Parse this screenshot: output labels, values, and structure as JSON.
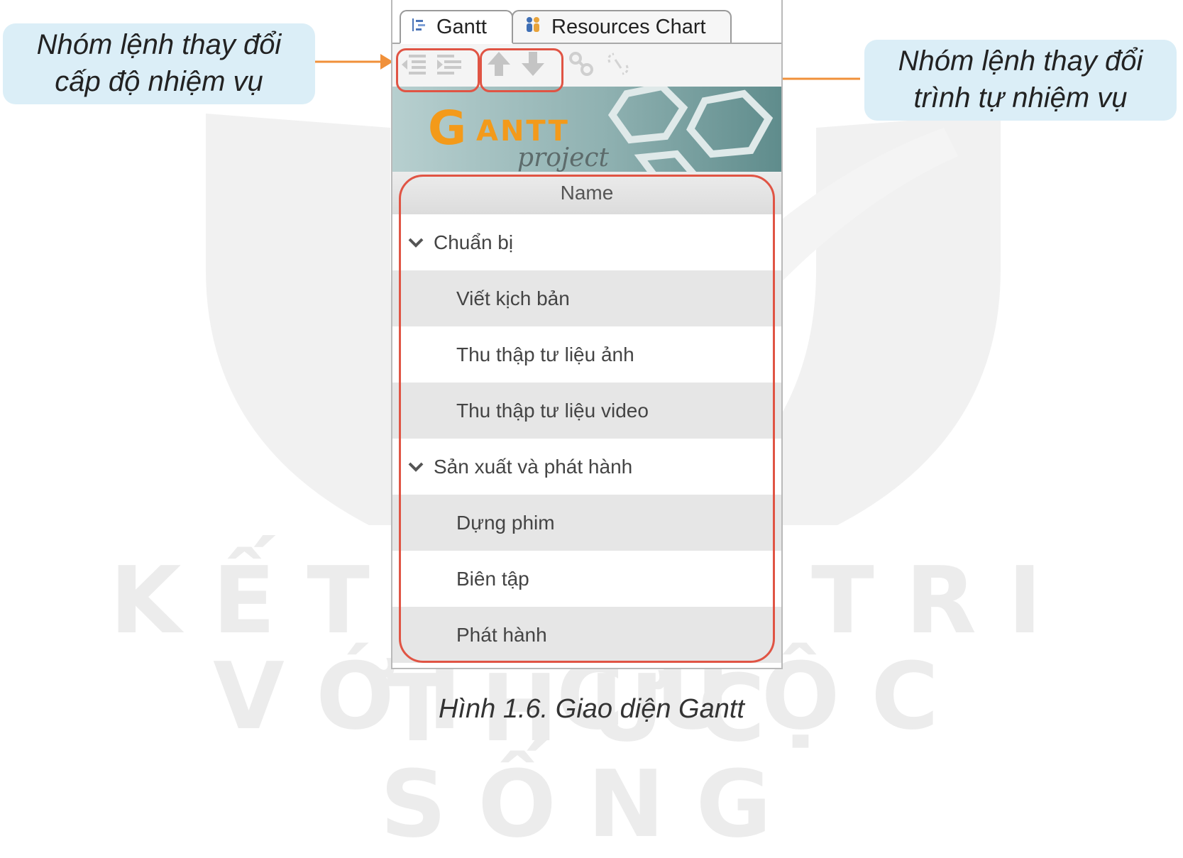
{
  "tabs": [
    {
      "label": "Gantt",
      "icon": "gantt-icon",
      "active": true
    },
    {
      "label": "Resources Chart",
      "icon": "resources-icon",
      "active": false
    }
  ],
  "toolbar": {
    "buttons": [
      "unindent-icon",
      "indent-icon",
      "move-up-icon",
      "move-down-icon",
      "link-icon",
      "unlink-icon"
    ]
  },
  "banner": {
    "logo": "GANTT project"
  },
  "table": {
    "header": "Name",
    "rows": [
      {
        "label": "Chuẩn bị",
        "level": 0,
        "expanded": true
      },
      {
        "label": "Viết kịch bản",
        "level": 1
      },
      {
        "label": "Thu thập tư liệu ảnh",
        "level": 1
      },
      {
        "label": "Thu thập tư liệu video",
        "level": 1
      },
      {
        "label": "Sản xuất và phát hành",
        "level": 0,
        "expanded": true
      },
      {
        "label": "Dựng phim",
        "level": 1
      },
      {
        "label": "Biên tập",
        "level": 1
      },
      {
        "label": "Phát hành",
        "level": 1
      }
    ]
  },
  "callouts": {
    "left": [
      "Nhóm lệnh thay đổi",
      "cấp độ nhiệm vụ"
    ],
    "right": [
      "Nhóm lệnh thay đổi",
      "trình tự nhiệm vụ"
    ]
  },
  "caption": "Hình 1.6. Giao diện Gantt",
  "watermark": [
    "KẾT NỐI TRI THỨC",
    "VỚI CUỘC SỐNG"
  ],
  "colors": {
    "highlight": "#e05444",
    "callout_bg": "#dbeef7",
    "arrow": "#f0903a",
    "logo": "#f39a1a"
  }
}
